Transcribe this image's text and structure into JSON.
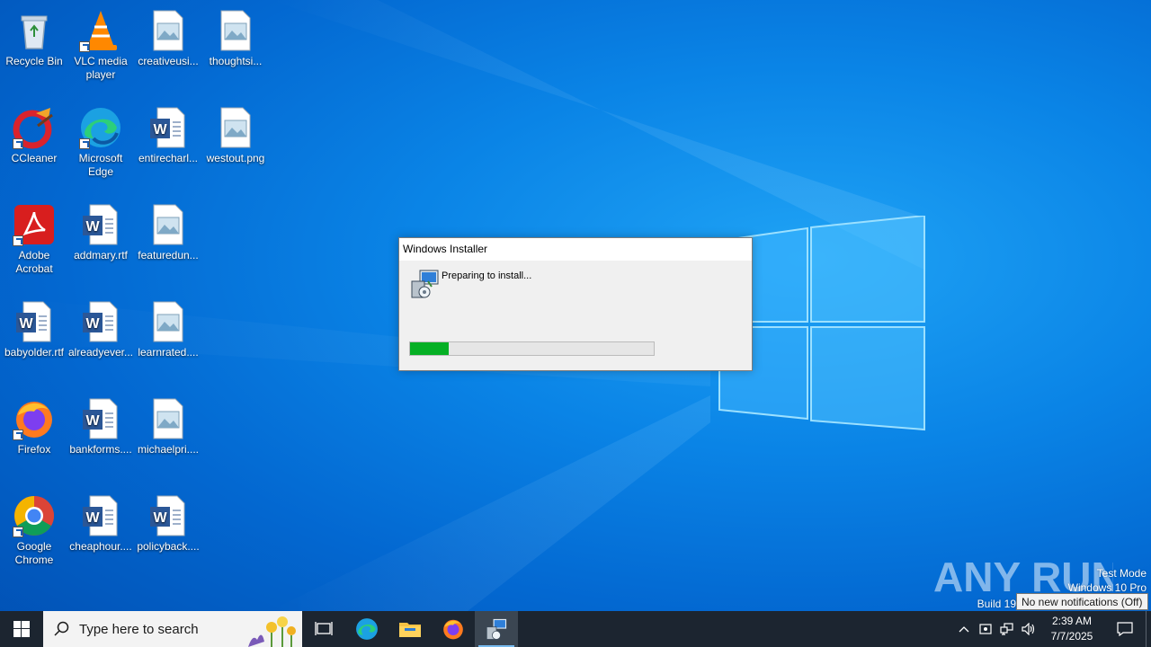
{
  "desktop": {
    "icons": [
      {
        "label": "Recycle Bin",
        "icon": "recycle-bin-icon"
      },
      {
        "label": "VLC media player",
        "icon": "vlc-icon"
      },
      {
        "label": "creativeusi...",
        "icon": "image-file-icon"
      },
      {
        "label": "thoughtsi...",
        "icon": "image-file-icon"
      },
      {
        "label": "CCleaner",
        "icon": "ccleaner-icon"
      },
      {
        "label": "Microsoft Edge",
        "icon": "edge-icon"
      },
      {
        "label": "entirecharl...",
        "icon": "word-doc-icon"
      },
      {
        "label": "westout.png",
        "icon": "image-file-icon"
      },
      {
        "label": "Adobe Acrobat",
        "icon": "acrobat-icon"
      },
      {
        "label": "addmary.rtf",
        "icon": "word-doc-icon"
      },
      {
        "label": "featuredun...",
        "icon": "image-file-icon"
      },
      {
        "label": "babyolder.rtf",
        "icon": "word-doc-icon"
      },
      {
        "label": "alreadyever...",
        "icon": "word-doc-icon"
      },
      {
        "label": "learnrated....",
        "icon": "image-file-icon"
      },
      {
        "label": "Firefox",
        "icon": "firefox-icon"
      },
      {
        "label": "bankforms....",
        "icon": "word-doc-icon"
      },
      {
        "label": "michaelpri....",
        "icon": "image-file-icon"
      },
      {
        "label": "Google Chrome",
        "icon": "chrome-icon"
      },
      {
        "label": "cheaphour....",
        "icon": "word-doc-icon"
      },
      {
        "label": "policyback....",
        "icon": "word-doc-icon"
      }
    ]
  },
  "dialog": {
    "title": "Windows Installer",
    "status": "Preparing to install...",
    "progress_fraction": 0.16,
    "progress_color": "#06b025"
  },
  "watermark": {
    "brand": "ANY RUN",
    "mode": "Test Mode",
    "edition": "Windows 10 Pro",
    "build": "Build 19"
  },
  "tooltip": "No new notifications (Off)",
  "taskbar": {
    "search_placeholder": "Type here to search",
    "time": "2:39 AM",
    "date": "7/7/2025",
    "accent": "#76b9ed"
  }
}
